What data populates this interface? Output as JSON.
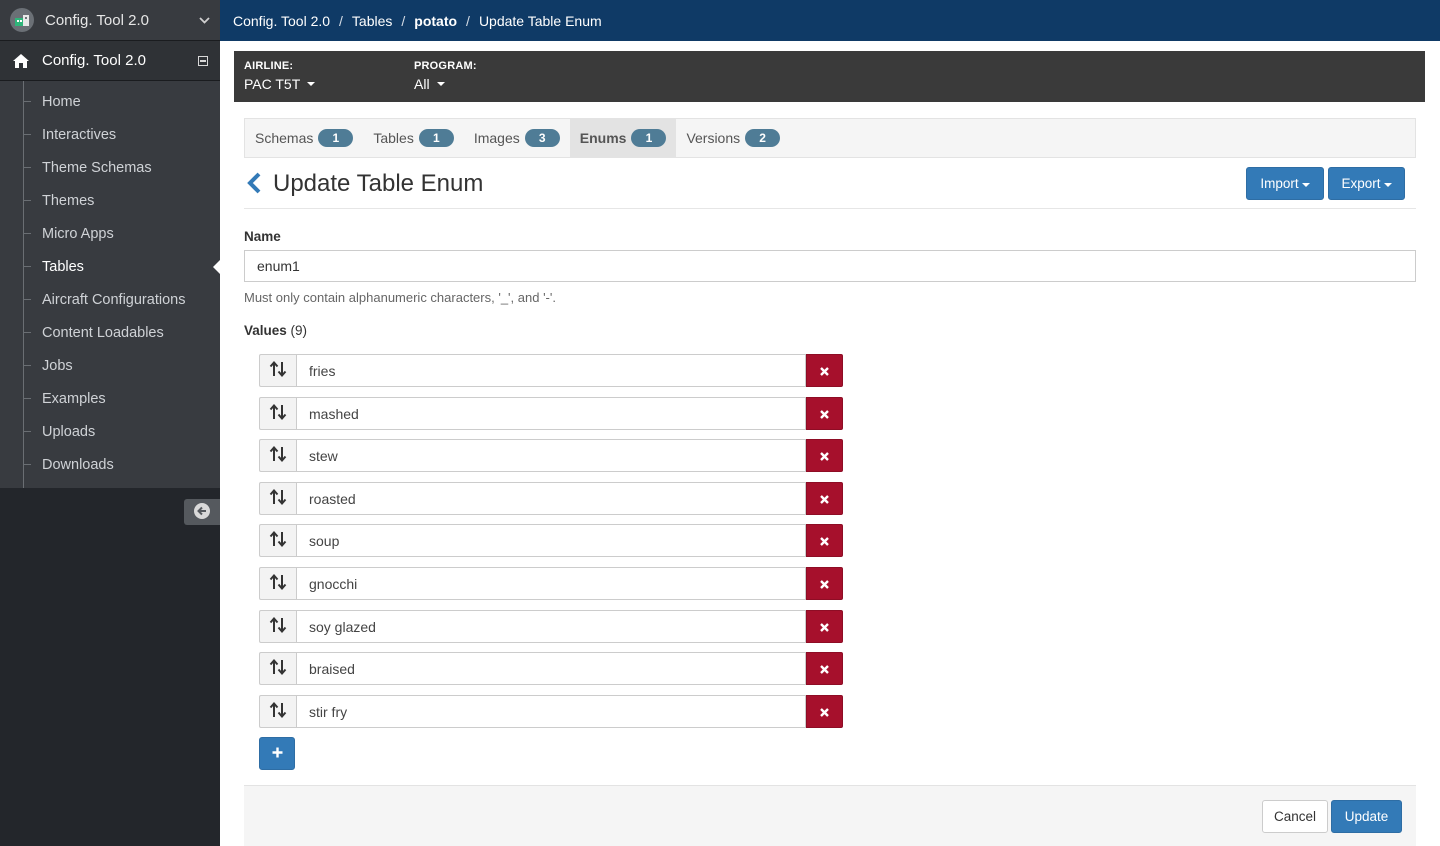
{
  "app": {
    "switcher_name": "Config. Tool 2.0",
    "root_item": "Config. Tool 2.0"
  },
  "sidebar": {
    "items": [
      {
        "label": "Home",
        "active": false
      },
      {
        "label": "Interactives",
        "active": false
      },
      {
        "label": "Theme Schemas",
        "active": false
      },
      {
        "label": "Themes",
        "active": false
      },
      {
        "label": "Micro Apps",
        "active": false
      },
      {
        "label": "Tables",
        "active": true
      },
      {
        "label": "Aircraft Configurations",
        "active": false
      },
      {
        "label": "Content Loadables",
        "active": false
      },
      {
        "label": "Jobs",
        "active": false
      },
      {
        "label": "Examples",
        "active": false
      },
      {
        "label": "Uploads",
        "active": false
      },
      {
        "label": "Downloads",
        "active": false
      }
    ]
  },
  "breadcrumb": [
    "Config. Tool 2.0",
    "Tables",
    "potato",
    "Update Table Enum"
  ],
  "context": {
    "airline_label": "AIRLINE:",
    "airline_value": "PAC T5T",
    "program_label": "PROGRAM:",
    "program_value": "All"
  },
  "tabs": [
    {
      "label": "Schemas",
      "count": "1",
      "active": false
    },
    {
      "label": "Tables",
      "count": "1",
      "active": false
    },
    {
      "label": "Images",
      "count": "3",
      "active": false
    },
    {
      "label": "Enums",
      "count": "1",
      "active": true
    },
    {
      "label": "Versions",
      "count": "2",
      "active": false
    }
  ],
  "header": {
    "title": "Update Table Enum",
    "import_label": "Import",
    "export_label": "Export"
  },
  "form": {
    "name_label": "Name",
    "name_value": "enum1",
    "name_help": "Must only contain alphanumeric characters, '_', and '-'.",
    "values_label": "Values",
    "values_count": "(9)",
    "values": [
      "fries",
      "mashed",
      "stew",
      "roasted",
      "soup",
      "gnocchi",
      "soy glazed",
      "braised",
      "stir fry"
    ]
  },
  "footer": {
    "cancel_label": "Cancel",
    "update_label": "Update"
  },
  "colors": {
    "topbar": "#0f3a66",
    "primary": "#337ab7",
    "danger": "#a6102c",
    "badge": "#4f7c96"
  }
}
